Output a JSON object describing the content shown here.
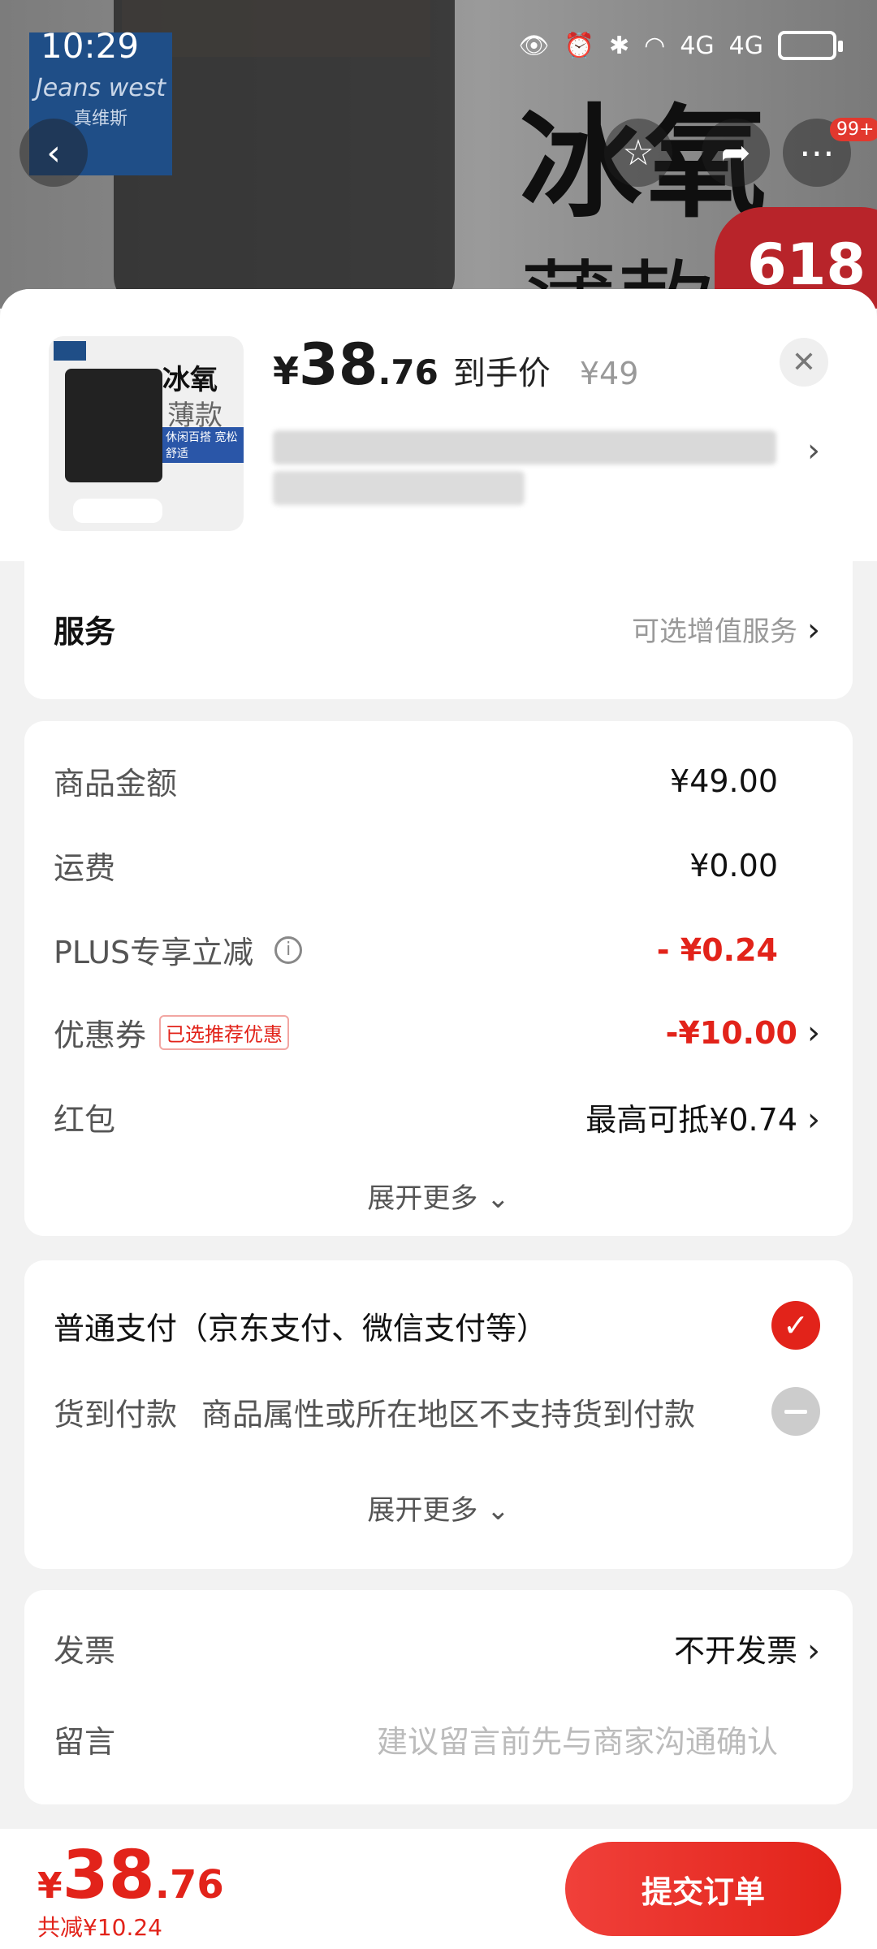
{
  "status_bar": {
    "time": "10:29",
    "network": "4G"
  },
  "background": {
    "brand_en": "Jeans west",
    "brand_cn": "真维斯",
    "banner_title": "冰氧",
    "banner_sub": "薄款",
    "badge": "618",
    "notif_count": "99+"
  },
  "product": {
    "currency": "¥",
    "price_int": "38",
    "price_dec": ".76",
    "arrive_label": "到手价",
    "original_price": "¥49",
    "thumb_title": "冰氧",
    "thumb_sub": "薄款",
    "thumb_tag": "休闲百搭 宽松舒适"
  },
  "service": {
    "label": "服务",
    "hint": "可选增值服务"
  },
  "amounts": {
    "goods_label": "商品金额",
    "goods_value": "¥49.00",
    "shipping_label": "运费",
    "shipping_value": "¥0.00",
    "plus_label": "PLUS专享立减",
    "plus_value": "- ¥0.24",
    "coupon_label": "优惠券",
    "coupon_tag": "已选推荐优惠",
    "coupon_value": "-¥10.00",
    "redpack_label": "红包",
    "redpack_value": "最高可抵¥0.74",
    "more": "展开更多"
  },
  "payment": {
    "normal_label": "普通支付（京东支付、微信支付等）",
    "cod_label": "货到付款",
    "cod_note": "商品属性或所在地区不支持货到付款",
    "more": "展开更多"
  },
  "invoice": {
    "label": "发票",
    "value": "不开发票"
  },
  "message": {
    "label": "留言",
    "placeholder": "建议留言前先与商家沟通确认"
  },
  "footer": {
    "currency": "¥",
    "total_int": "38",
    "total_dec": ".76",
    "saved": "共减¥10.24",
    "submit": "提交订单"
  },
  "colors": {
    "accent": "#e2231a",
    "background": "#f2f2f2"
  }
}
